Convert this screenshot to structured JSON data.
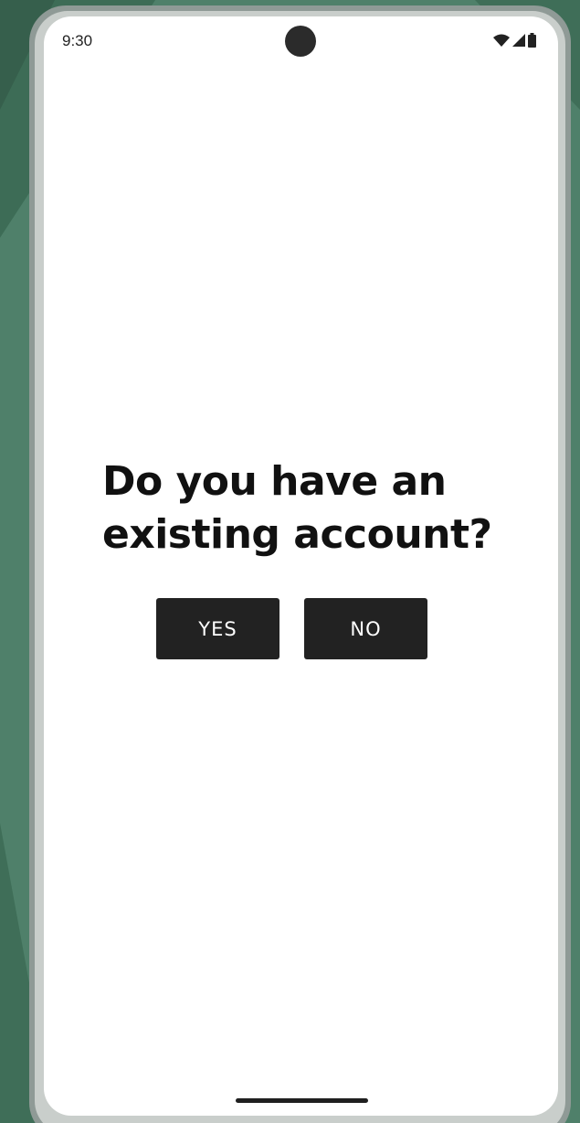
{
  "status_bar": {
    "time": "9:30",
    "icons": [
      "wifi-icon",
      "signal-icon",
      "battery-icon"
    ]
  },
  "prompt": {
    "question": "Do you have an existing account?"
  },
  "buttons": {
    "yes_label": "YES",
    "no_label": "NO"
  },
  "colors": {
    "background": "#4a7a62",
    "button": "#222222",
    "button_text": "#ffffff",
    "screen": "#ffffff"
  }
}
